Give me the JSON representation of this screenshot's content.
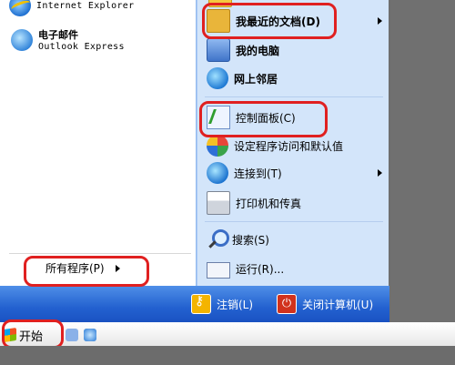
{
  "left_pane": {
    "ie": {
      "label": "Internet Explorer"
    },
    "email": {
      "title": "电子邮件",
      "subtitle": "Outlook Express"
    },
    "all_programs": {
      "label": "所有程序(P)"
    }
  },
  "right_pane": {
    "recent_docs": "我最近的文档(D)",
    "my_computer": "我的电脑",
    "network": "网上邻居",
    "control_panel": "控制面板(C)",
    "set_defaults": "设定程序访问和默认值",
    "connect_to": "连接到(T)",
    "printers": "打印机和传真",
    "search": "搜索(S)",
    "run": "运行(R)..."
  },
  "bottom_bar": {
    "logoff": "注销(L)",
    "shutdown": "关闭计算机(U)"
  },
  "taskbar": {
    "start": "开始"
  },
  "colors": {
    "highlight": "#e02020",
    "start_blue": "#2361d0"
  }
}
